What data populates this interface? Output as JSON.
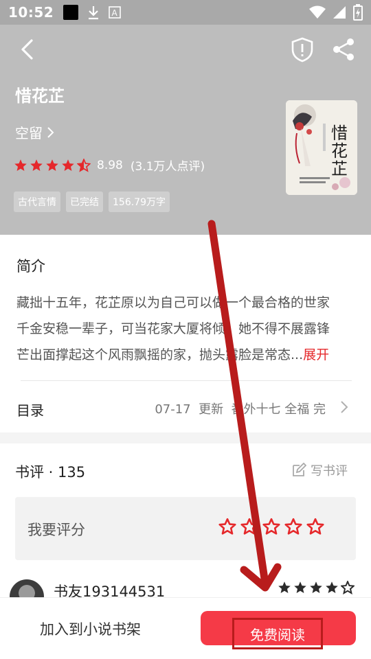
{
  "status_bar": {
    "time": "10:52",
    "icons": [
      "black-square-icon",
      "download-icon",
      "a-font-icon",
      "wifi-icon",
      "signal-icon",
      "battery-icon"
    ]
  },
  "book": {
    "title": "惜花芷",
    "author": "空留",
    "rating": "8.98",
    "rating_count": "(3.1万人点评)",
    "tags": [
      "古代言情",
      "已完结",
      "156.79万字"
    ],
    "cover_title": "惜花芷"
  },
  "intro": {
    "heading": "简介",
    "lines": [
      "藏拙十五年，花芷原以为自己可以做一个最合格的世家",
      "千金安稳一辈子，可当花家大厦将倾，她不得不展露锋",
      "芒出面撑起这个风雨飘摇的家，抛头露脸是常态..."
    ],
    "more_label": "展开"
  },
  "toc": {
    "label": "目录",
    "update_date": "07-17",
    "update_label": "更新",
    "latest_chapter": "番外十七 全福 完"
  },
  "reviews": {
    "title": "书评 · 135",
    "write_label": "写书评",
    "rate_prompt": "我要评分",
    "first_reviewer": "书友193144531"
  },
  "bottom": {
    "add_shelf_label": "加入到小说书架",
    "read_label": "免费阅读"
  },
  "colors": {
    "accent": "#f53a47",
    "rating_star": "#e5282b",
    "header_bg": "#bdbdbd",
    "annotation": "#b81c1c"
  }
}
